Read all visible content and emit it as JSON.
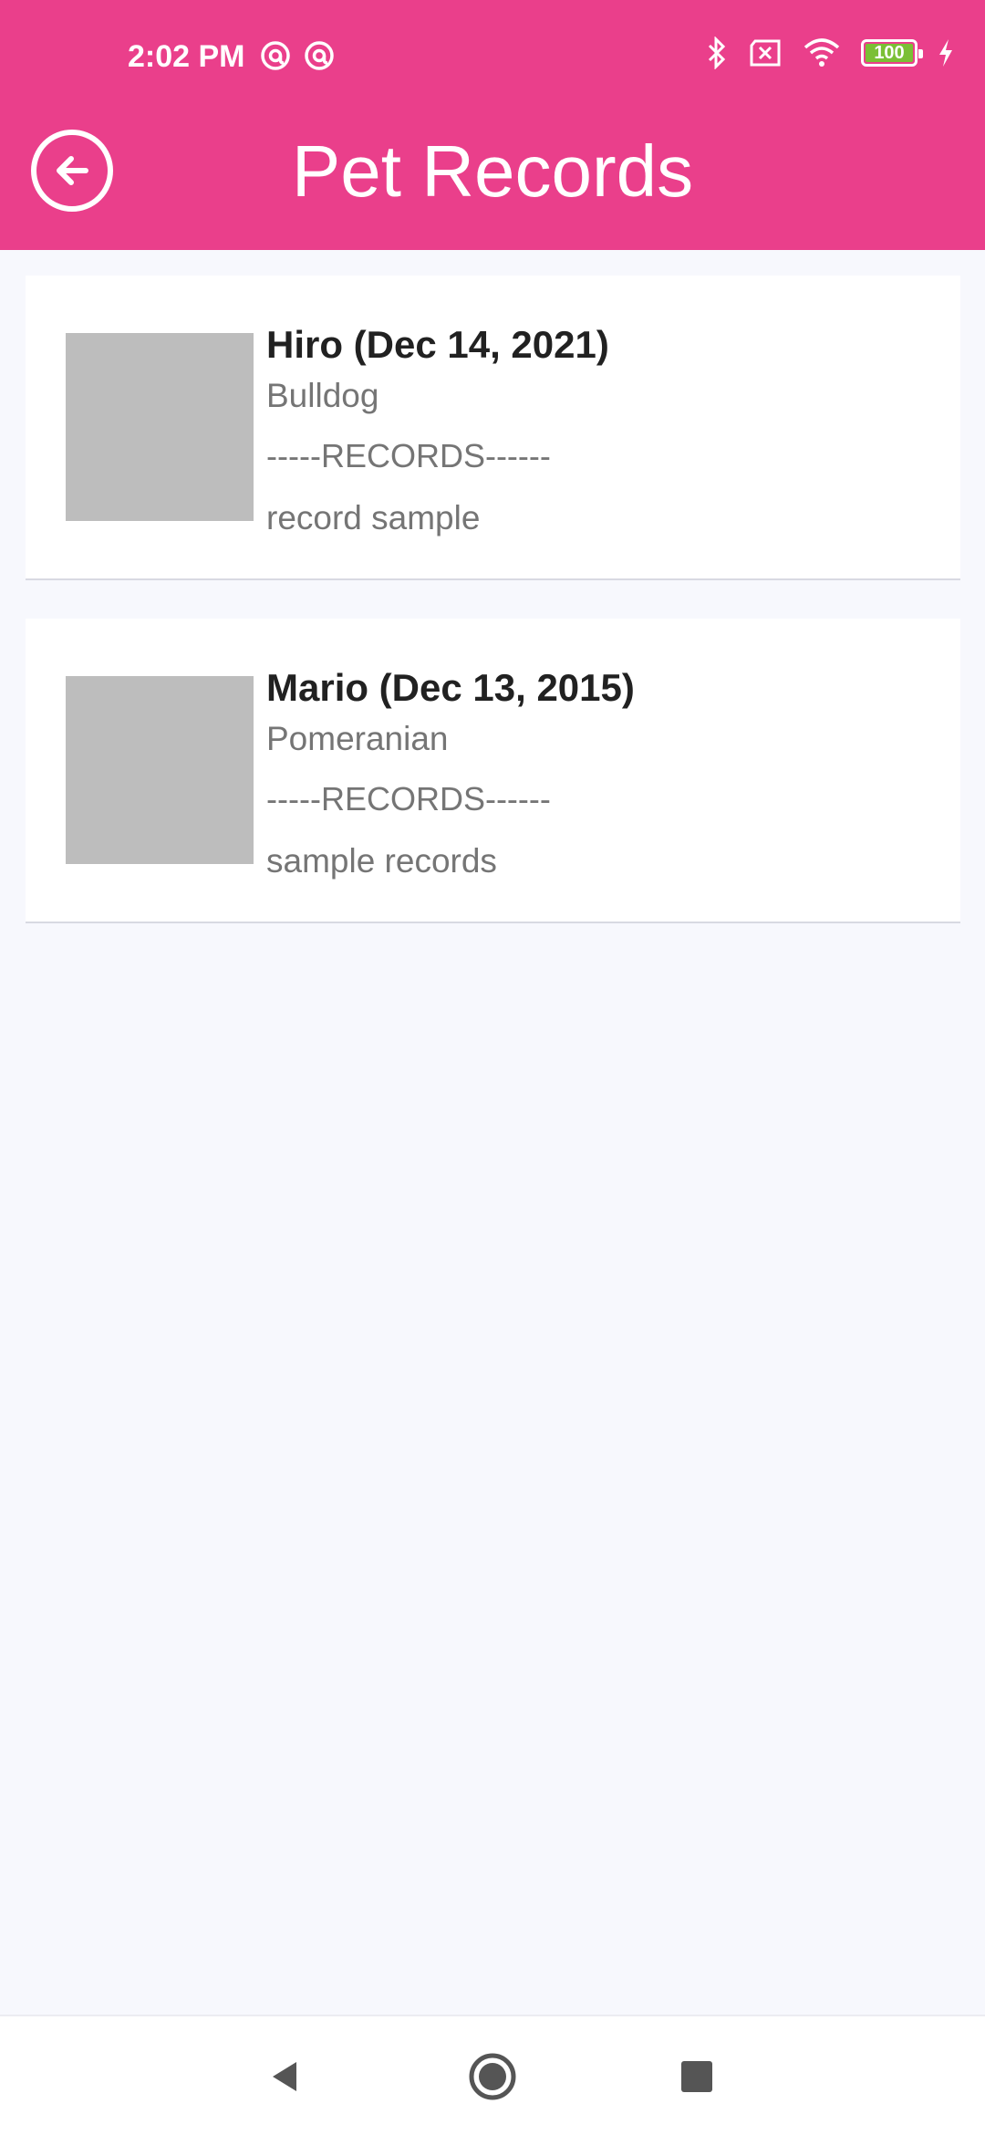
{
  "status_bar": {
    "time": "2:02 PM",
    "battery_level": "100",
    "icons": [
      "at-sign-icon",
      "at-sign-icon",
      "bluetooth-icon",
      "sim-off-icon",
      "wifi-icon",
      "battery-icon",
      "charging-icon"
    ]
  },
  "app_bar": {
    "title": "Pet Records",
    "back_icon": "arrow-left-circle-icon",
    "color": "#ea3f8b"
  },
  "pets": [
    {
      "name": "Hiro (Dec 14, 2021)",
      "breed": "Bulldog",
      "divider": "-----RECORDS------",
      "record": "record sample"
    },
    {
      "name": "Mario (Dec 13, 2015)",
      "breed": "Pomeranian",
      "divider": "-----RECORDS------",
      "record": "sample records"
    }
  ],
  "nav_bar": {
    "icons": [
      "back-triangle-icon",
      "home-circle-icon",
      "recents-square-icon"
    ]
  }
}
